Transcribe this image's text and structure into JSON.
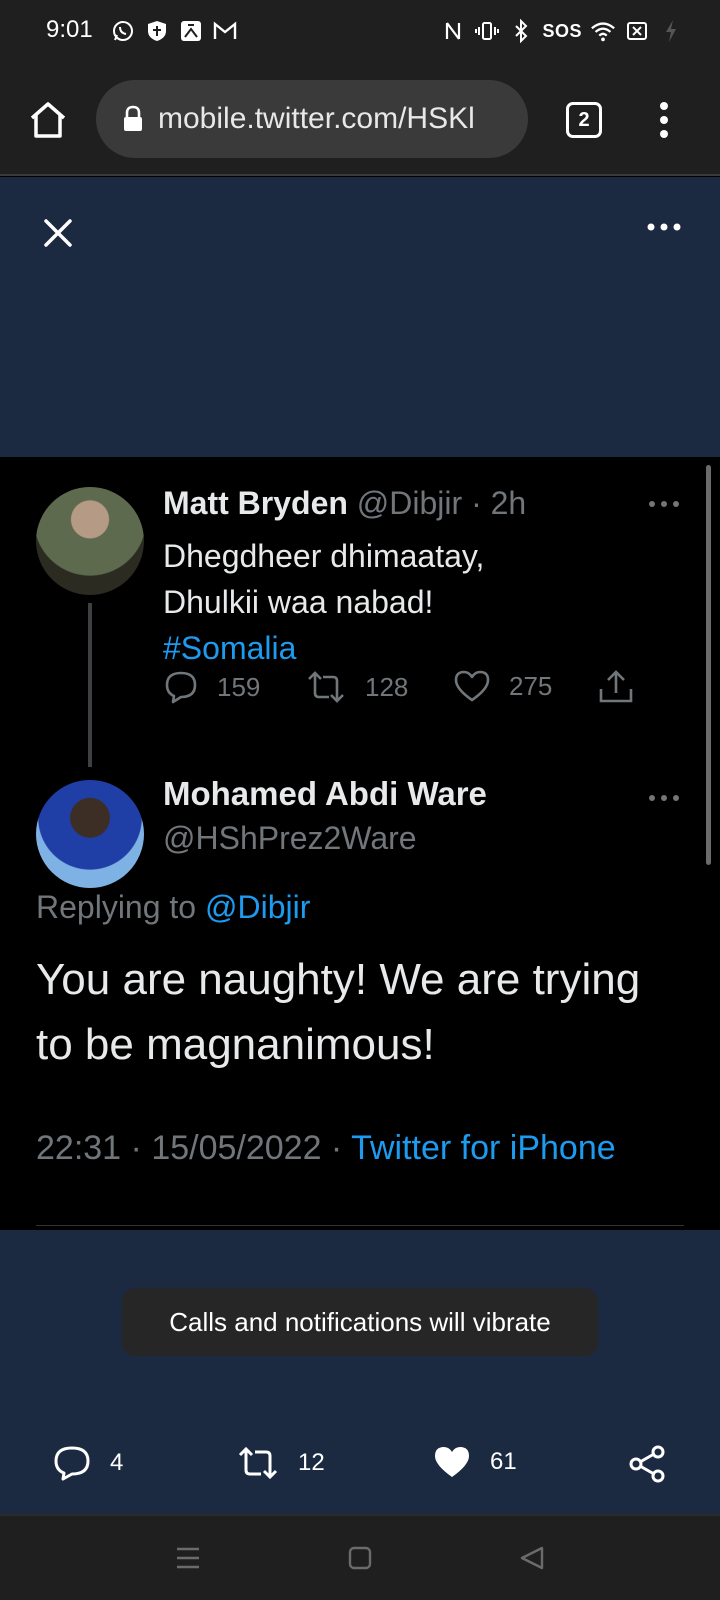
{
  "status_bar": {
    "time": "9:01",
    "sos": "SOS"
  },
  "browser": {
    "url": "mobile.twitter.com/HSKl",
    "tab_count": "2"
  },
  "tweet_parent": {
    "name": "Matt Bryden",
    "handle": "@Dibjir",
    "separator": " · ",
    "age": "2h",
    "body_line1": "Dhegdheer dhimaatay,",
    "body_line2": "Dhulkii waa nabad!",
    "hashtag": "#Somalia",
    "replies": "159",
    "retweets": "128",
    "likes": "275"
  },
  "tweet_main": {
    "name": "Mohamed Abdi Ware",
    "handle": "@HShPrez2Ware",
    "replying_prefix": "Replying to ",
    "replying_to": "@Dibjir",
    "body": "You are naughty! We are trying to be magnanimous!",
    "time": "22:31",
    "date": "15/05/2022",
    "dot": " · ",
    "source": "Twitter for iPhone"
  },
  "toast": {
    "text": "Calls and notifications will vibrate"
  },
  "bottom_actions": {
    "replies": "4",
    "retweets": "12",
    "likes": "61"
  },
  "colors": {
    "accent_blue": "#1d9bf0",
    "media_bg": "#1b2a41",
    "muted": "#71767b"
  }
}
